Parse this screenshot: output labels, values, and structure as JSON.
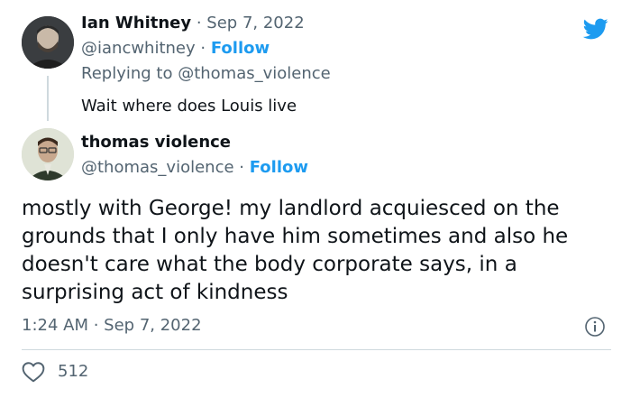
{
  "reply_tweet": {
    "name": "Ian Whitney",
    "separator": " · ",
    "date": "Sep 7, 2022",
    "handle": "@iancwhitney",
    "follow_sep": " · ",
    "follow_label": "Follow",
    "replying_prefix": "Replying to ",
    "replying_handle": "@thomas_violence",
    "text": "Wait where does Louis live"
  },
  "main_tweet": {
    "name": "thomas violence",
    "handle": "@thomas_violence",
    "follow_sep": " · ",
    "follow_label": "Follow",
    "text": "mostly with George! my landlord acquiesced on the grounds that I only have him sometimes and also he doesn't care what the body corporate says, in a surprising act of kindness",
    "time": "1:24 AM",
    "meta_sep": " · ",
    "date": "Sep 7, 2022",
    "likes": "512"
  },
  "icons": {
    "brand": "twitter-bird-icon",
    "info": "info-icon",
    "like": "heart-icon"
  },
  "colors": {
    "accent": "#1d9bf0",
    "text": "#0f1419",
    "muted": "#536471",
    "divider": "#cfd9de"
  }
}
